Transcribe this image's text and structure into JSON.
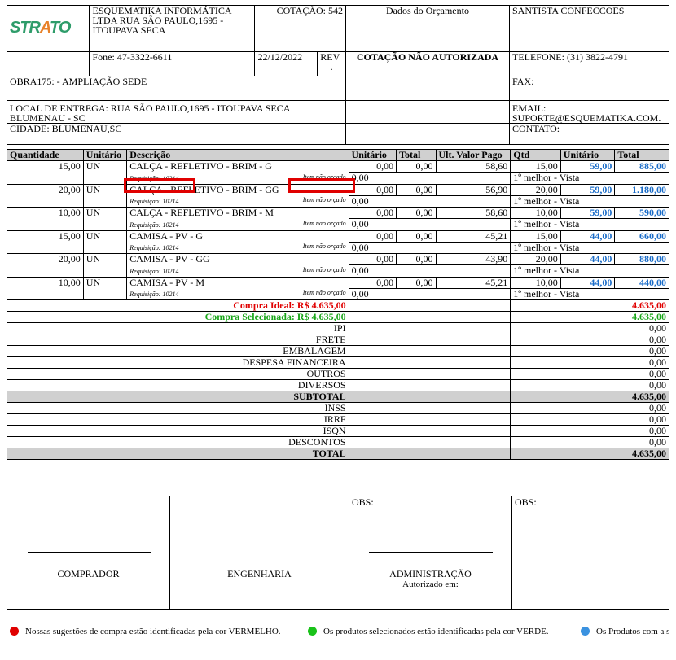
{
  "company": {
    "logo_text_a": "STR",
    "logo_text_b": "A",
    "logo_text_c": "TO",
    "name_lines": [
      "ESQUEMATIKA INFORMÁTICA",
      "LTDA RUA SÃO PAULO,1695 -",
      "ITOUPAVA SECA"
    ],
    "phone": "Fone: 47-3322-6611",
    "date": "22/12/2022",
    "rev_label": "REV",
    "rev_value": "."
  },
  "quote": {
    "number_label": "COTAÇÃO: 542",
    "data_label": "Dados do Orçamento",
    "status": "COTAÇÃO NÃO AUTORIZADA"
  },
  "supplier": {
    "name": "SANTISTA CONFECCOES",
    "phone": "TELEFONE: (31) 3822-4791",
    "fax": "FAX:",
    "email_label": "EMAIL:",
    "email": "SUPORTE@ESQUEMATIKA.COM.",
    "contact": "CONTATO:"
  },
  "work": {
    "obra": "OBRA175: - AMPLIAÇÃO SEDE",
    "delivery_1": "LOCAL DE ENTREGA: RUA SÃO PAULO,1695 - ITOUPAVA SECA",
    "delivery_2": "BLUMENAU - SC",
    "city": "CIDADE: BLUMENAU,SC"
  },
  "columns": {
    "qty": "Quantidade",
    "unit": "Unitário",
    "desc": "Descrição",
    "unit_price": "Unitário",
    "total": "Total",
    "last_price": "Ult. Valor Pago",
    "s_qty": "Qtd",
    "s_unit": "Unitário",
    "s_total": "Total"
  },
  "items": [
    {
      "qty": "15,00",
      "unit": "UN",
      "desc": "CALÇA - REFLETIVO - BRIM - G",
      "req": "Requisição: 10214",
      "note": "Item não orçado",
      "price": "0,00",
      "total": "0,00",
      "last": "58,60",
      "extra": "0,00",
      "s_qty": "15,00",
      "s_unit": "59,00",
      "s_total": "885,00",
      "rank": "1º melhor - Vista"
    },
    {
      "qty": "20,00",
      "unit": "UN",
      "desc": "CALÇA - REFLETIVO - BRIM - GG",
      "req": "Requisição: 10214",
      "note": "Item não orçado",
      "price": "0,00",
      "total": "0,00",
      "last": "56,90",
      "extra": "0,00",
      "s_qty": "20,00",
      "s_unit": "59,00",
      "s_total": "1.180,00",
      "rank": "1º melhor - Vista"
    },
    {
      "qty": "10,00",
      "unit": "UN",
      "desc": "CALÇA - REFLETIVO - BRIM - M",
      "req": "Requisição: 10214",
      "note": "Item não orçado",
      "price": "0,00",
      "total": "0,00",
      "last": "58,60",
      "extra": "0,00",
      "s_qty": "10,00",
      "s_unit": "59,00",
      "s_total": "590,00",
      "rank": "1º melhor - Vista"
    },
    {
      "qty": "15,00",
      "unit": "UN",
      "desc": "CAMISA - PV - G",
      "req": "Requisição: 10214",
      "note": "Item não orçado",
      "price": "0,00",
      "total": "0,00",
      "last": "45,21",
      "extra": "0,00",
      "s_qty": "15,00",
      "s_unit": "44,00",
      "s_total": "660,00",
      "rank": "1º melhor - Vista"
    },
    {
      "qty": "20,00",
      "unit": "UN",
      "desc": "CAMISA - PV - GG",
      "req": "Requisição: 10214",
      "note": "Item não orçado",
      "price": "0,00",
      "total": "0,00",
      "last": "43,90",
      "extra": "0,00",
      "s_qty": "20,00",
      "s_unit": "44,00",
      "s_total": "880,00",
      "rank": "1º melhor - Vista"
    },
    {
      "qty": "10,00",
      "unit": "UN",
      "desc": "CAMISA - PV - M",
      "req": "Requisição: 10214",
      "note": "Item não orçado",
      "price": "0,00",
      "total": "0,00",
      "last": "45,21",
      "extra": "0,00",
      "s_qty": "10,00",
      "s_unit": "44,00",
      "s_total": "440,00",
      "rank": "1º melhor - Vista"
    }
  ],
  "summary": {
    "ideal": "Compra Ideal: R$ 4.635,00",
    "ideal_value": "4.635,00",
    "selected": "Compra Selecionada: R$ 4.635,00",
    "selected_value": "4.635,00",
    "rows": [
      {
        "label": "IPI",
        "value": "0,00",
        "bold": false
      },
      {
        "label": "FRETE",
        "value": "0,00",
        "bold": false
      },
      {
        "label": "EMBALAGEM",
        "value": "0,00",
        "bold": false
      },
      {
        "label": "DESPESA FINANCEIRA",
        "value": "0,00",
        "bold": false
      },
      {
        "label": "OUTROS",
        "value": "0,00",
        "bold": false
      },
      {
        "label": "DIVERSOS",
        "value": "0,00",
        "bold": false
      },
      {
        "label": "SUBTOTAL",
        "value": "4.635,00",
        "bold": true
      },
      {
        "label": "INSS",
        "value": "0,00",
        "bold": false
      },
      {
        "label": "IRRF",
        "value": "0,00",
        "bold": false
      },
      {
        "label": "ISQN",
        "value": "0,00",
        "bold": false
      },
      {
        "label": "DESCONTOS",
        "value": "0,00",
        "bold": false
      },
      {
        "label": "TOTAL",
        "value": "4.635,00",
        "bold": true
      }
    ]
  },
  "signatures": {
    "buyer": "COMPRADOR",
    "engineering": "ENGENHARIA",
    "obs_1": "OBS:",
    "admin": "ADMINISTRAÇÃO",
    "authorized": "Autorizado em:",
    "obs_2": "OBS:"
  },
  "legend": {
    "red_text": "Nossas sugestões de compra estão identificadas pela cor VERMELHO.",
    "green_text": "Os produtos selecionados estão identificadas pela cor VERDE.",
    "blue_text": "Os Produtos com a s",
    "red_color": "#e00000",
    "green_color": "#19c219",
    "blue_color": "#3a92e0"
  }
}
